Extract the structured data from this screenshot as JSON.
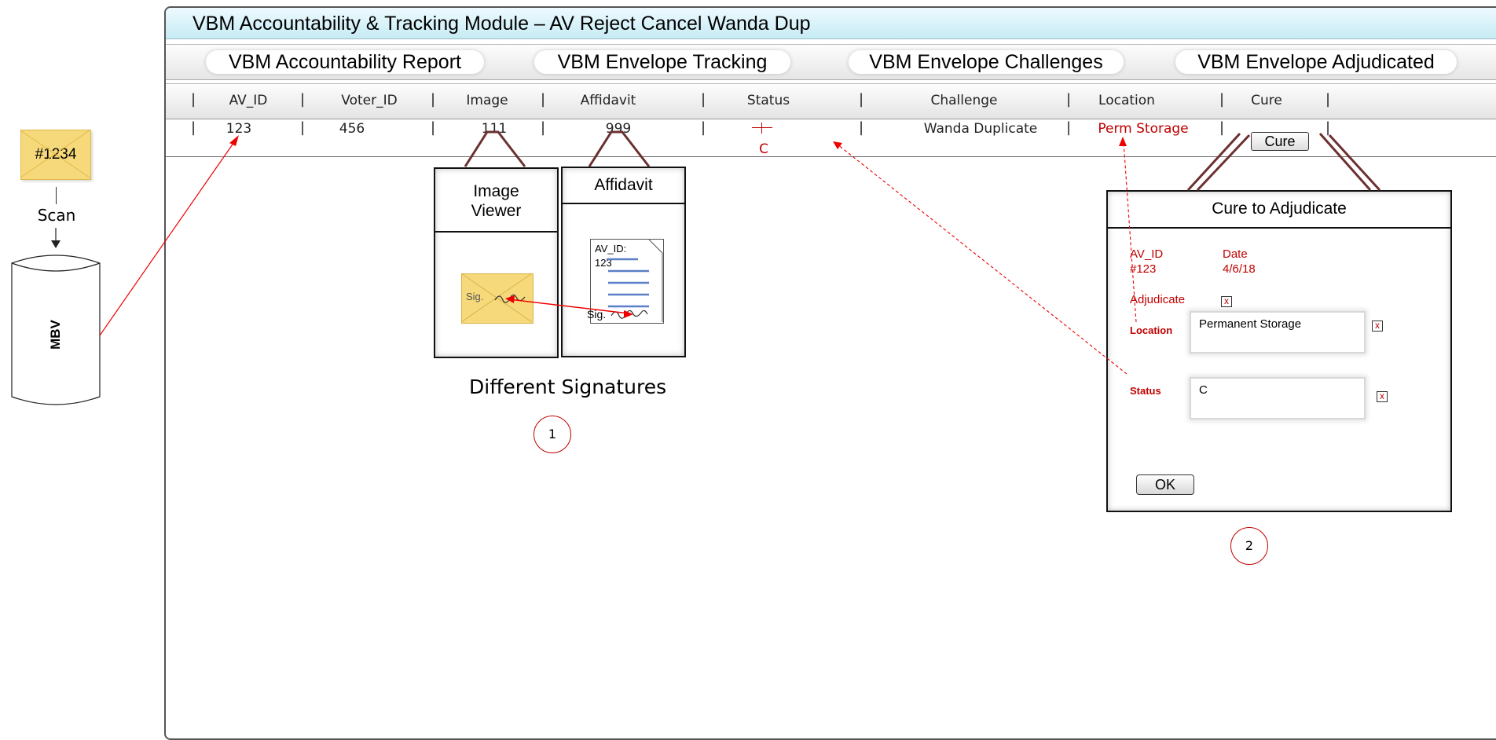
{
  "envelope": {
    "label": "#1234"
  },
  "scan_label": "Scan",
  "mbv_label": "MBV",
  "window": {
    "title": "VBM Accountability & Tracking Module – AV Reject Cancel Wanda Dup"
  },
  "tabs": [
    {
      "label": "VBM Accountability Report"
    },
    {
      "label": "VBM Envelope Tracking"
    },
    {
      "label": "VBM Envelope Challenges"
    },
    {
      "label": "VBM Envelope Adjudicated"
    }
  ],
  "columns": {
    "av_id": "AV_ID",
    "voter_id": "Voter_ID",
    "image": "Image",
    "affidavit": "Affidavit",
    "status": "Status",
    "challenge": "Challenge",
    "location": "Location",
    "cure": "Cure"
  },
  "row": {
    "av_id": "123",
    "voter_id": "456",
    "image": "111",
    "affidavit": "999",
    "status": "C",
    "challenge": "Wanda Duplicate",
    "location": "Perm Storage",
    "cure_button": "Cure"
  },
  "image_viewer": {
    "title": "Image Viewer",
    "sig_label": "Sig."
  },
  "affidavit_panel": {
    "title": "Affidavit",
    "doc_text": "AV_ID: 123",
    "sig_label": "Sig."
  },
  "caption": "Different Signatures",
  "step1": "1",
  "step2": "2",
  "cure_dialog": {
    "title": "Cure to Adjudicate",
    "av_id_label": "AV_ID",
    "av_id_value": "#123",
    "date_label": "Date",
    "date_value": "4/6/18",
    "adjudicate_label": "Adjudicate",
    "location_label": "Location",
    "location_value": "Permanent Storage",
    "status_label": "Status",
    "status_value": "C",
    "ok_label": "OK",
    "check_mark": "x"
  },
  "colors": {
    "accent_red": "#c00000",
    "title_blue": "#c7ebf4",
    "envelope_yellow": "#f6d97a"
  }
}
